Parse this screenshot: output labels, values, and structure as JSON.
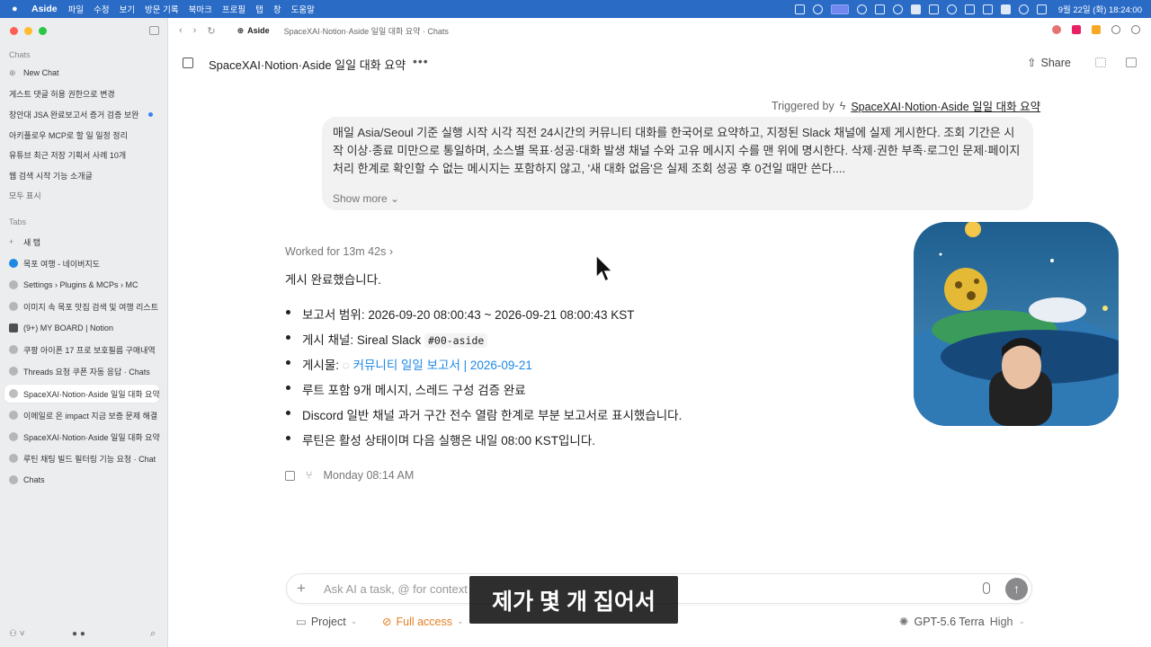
{
  "menubar": {
    "app_name": "Aside",
    "menus": [
      "파일",
      "수정",
      "보기",
      "방문 기록",
      "북마크",
      "프로필",
      "탭",
      "창",
      "도움말"
    ],
    "clock": "9월 22일 (화) 18:24:00"
  },
  "sidebar": {
    "chats_header": "Chats",
    "new_chat": "New Chat",
    "chats": [
      "게스트 댓글 허용 권한으로 변경",
      "장안대 JSA 완료보고서 증거 검증 보완",
      "아키플로우 MCP로 할 일 일정 정리",
      "유튜브 최근 저장 기획서 사례 10개",
      "웹 검색 시작 기능 소개글",
      "모두 표시"
    ],
    "tabs_header": "Tabs",
    "new_tab": "새 탭",
    "tabs": [
      "목포 여행 - 네이버지도",
      "Settings › Plugins & MCPs › MC",
      "이미지 속 목포 맛집 검색 및 여행 리스트",
      "(9+) MY BOARD | Notion",
      "쿠팡 아이폰 17 프로 보호필름 구매내역",
      "Threads 요청 쿠폰 자동 응답 · Chats",
      "SpaceXAI·Notion·Aside 일일 대화 요약",
      "이메일로 온 impact 지금 보증 문제 해결",
      "SpaceXAI·Notion·Aside 일일 대화 요약",
      "루틴 채팅 빌드 필터링 기능 요청 · Chat",
      "Chats"
    ]
  },
  "topbar": {
    "app_label": "Aside",
    "breadcrumb": "SpaceXAI·Notion·Aside 일일 대화 요약 · Chats"
  },
  "header": {
    "title": "SpaceXAI·Notion·Aside 일일 대화 요약",
    "share_label": "Share"
  },
  "trigger": {
    "prefix": "Triggered by",
    "link": "SpaceXAI·Notion·Aside 일일 대화 요약"
  },
  "prompt": {
    "text": "매일 Asia/Seoul 기준 실행 시작 시각 직전 24시간의 커뮤니티 대화를 한국어로 요약하고, 지정된 Slack 채널에 실제 게시한다. 조회 기간은 시작 이상·종료 미만으로 통일하며, 소스별 목표·성공·대화 발생 채널 수와 고유 메시지 수를 맨 위에 명시한다. 삭제·권한 부족·로그인 문제·페이지 처리 한계로 확인할 수 없는 메시지는 포함하지 않고, '새 대화 없음'은 실제 조회 성공 후 0건일 때만 쓴다....",
    "show_more": "Show more"
  },
  "response": {
    "worked": "Worked for 13m 42s",
    "status": "게시 완료했습니다.",
    "b1": "보고서 범위: 2026-09-20 08:00:43 ~ 2026-09-21 08:00:43 KST",
    "b2_prefix": "게시 채널: Sireal Slack",
    "b2_code": "#00-aside",
    "b3_prefix": "게시물:",
    "b3_link": "커뮤니티 일일 보고서 | 2026-09-21",
    "b4": "루트 포함 9개 메시지, 스레드 구성 검증 완료",
    "b5": "Discord 일반 채널 과거 구간 전수 열람 한계로 부분 보고서로 표시했습니다.",
    "b6": "루틴은 활성 상태이며 다음 실행은 내일 08:00 KST입니다.",
    "timestamp": "Monday 08:14 AM"
  },
  "composer": {
    "placeholder": "Ask AI a task, @ for context",
    "project": "Project",
    "access": "Full access",
    "model": "GPT-5.6 Terra",
    "effort": "High"
  },
  "caption": "제가 몇 개 집어서",
  "colors": {
    "menubar": "#2a6bc6",
    "accent_link": "#1e88e5",
    "full_access": "#e67e22"
  }
}
